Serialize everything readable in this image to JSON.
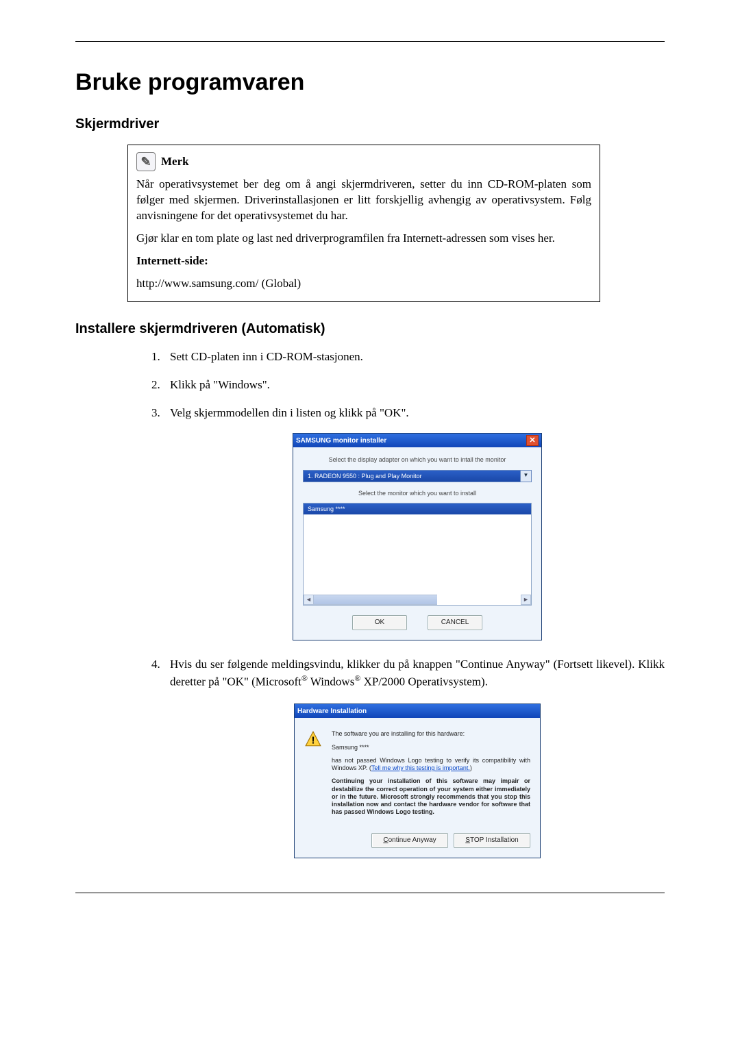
{
  "page": {
    "title": "Bruke programvaren",
    "section1": "Skjermdriver",
    "section2": "Installere skjermdriveren (Automatisk)"
  },
  "merk": {
    "heading": "Merk",
    "p1": "Når operativsystemet ber deg om å angi skjermdriveren, setter du inn CD-ROM-platen som følger med skjermen. Driverinstallasjonen er litt forskjellig avhengig av operativsystem. Følg anvisningene for det operativsystemet du har.",
    "p2": "Gjør klar en tom plate og last ned driverprogramfilen fra Internett-adressen som vises her.",
    "label": "Internett-side:",
    "url": "http://www.samsung.com/ (Global)"
  },
  "steps": {
    "s1": "Sett CD-platen inn i CD-ROM-stasjonen.",
    "s2": "Klikk på \"Windows\".",
    "s3": "Velg skjermmodellen din i listen og klikk på \"OK\".",
    "s4a": "Hvis du ser følgende meldingsvindu, klikker du på knappen \"Continue Anyway\" (Fortsett likevel). Klikk deretter på \"OK\" (Microsoft",
    "s4b": " Windows",
    "s4c": " XP/2000 Operativsystem)."
  },
  "installer": {
    "title": "SAMSUNG monitor installer",
    "label1": "Select the display adapter on which you want to intall the monitor",
    "dropdown": "1. RADEON 9550 : Plug and Play Monitor",
    "label2": "Select the monitor which you want to install",
    "listitem": "Samsung ****",
    "ok": "OK",
    "cancel": "CANCEL"
  },
  "warning": {
    "title": "Hardware Installation",
    "p1": "The software you are installing for this hardware:",
    "p2": "Samsung ****",
    "p3a": "has not passed Windows Logo testing to verify its compatibility with Windows XP. (",
    "link": "Tell me why this testing is important.",
    "p3b": ")",
    "p4": "Continuing your installation of this software may impair or destabilize the correct operation of your system either immediately or in the future. Microsoft strongly recommends that you stop this installation now and contact the hardware vendor for software that has passed Windows Logo testing.",
    "continue": "Continue Anyway",
    "stop": "STOP Installation"
  }
}
